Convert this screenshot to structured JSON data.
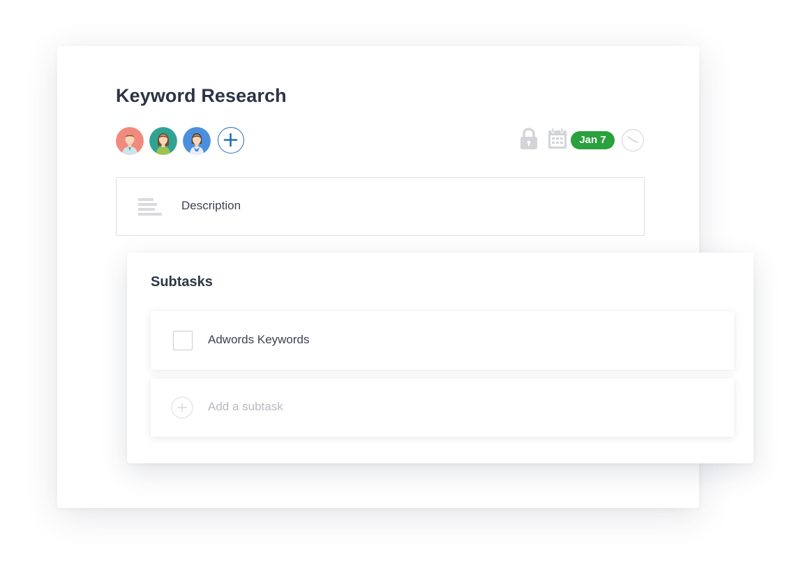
{
  "task": {
    "title": "Keyword Research",
    "assignees": [
      {
        "icon": "avatar-man-icon",
        "bg": "#f08a7e"
      },
      {
        "icon": "avatar-woman-icon",
        "bg": "#2fa394"
      },
      {
        "icon": "avatar-woman-2-icon",
        "bg": "#4b8fde"
      }
    ],
    "add_assignee_icon": "plus-icon",
    "due_date": "Jan 7",
    "description_placeholder": "Description"
  },
  "subtasks": {
    "title": "Subtasks",
    "items": [
      {
        "label": "Adwords Keywords",
        "checked": false
      }
    ],
    "add_placeholder": "Add a subtask"
  },
  "colors": {
    "accent_blue": "#1f6fb2",
    "due_green": "#2aa13d",
    "title_text": "#2b3445",
    "muted_icon": "#d2d4d8"
  }
}
